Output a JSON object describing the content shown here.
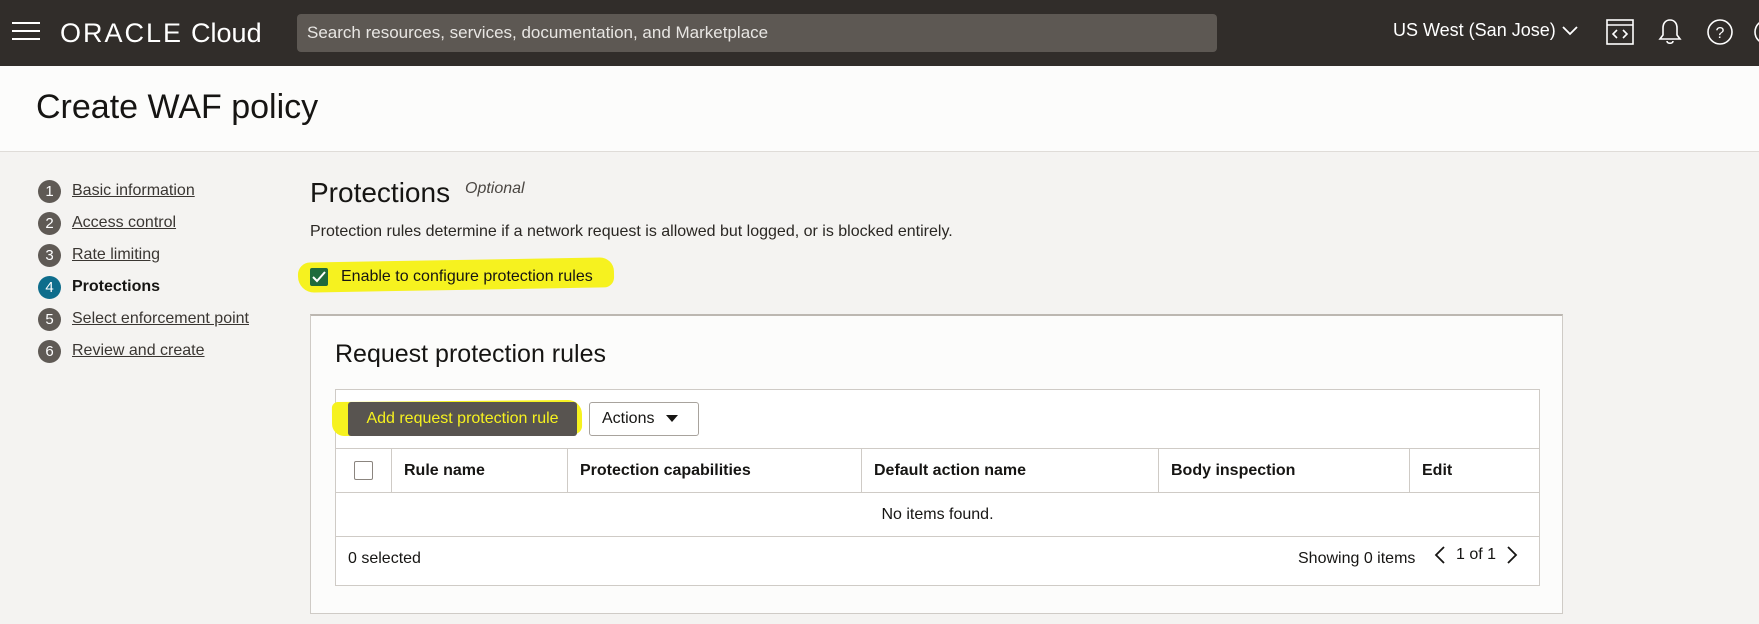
{
  "header": {
    "brand": "ORACLE",
    "product": "Cloud",
    "search_placeholder": "Search resources, services, documentation, and Marketplace",
    "region": "US West (San Jose)",
    "icons": [
      "hamburger-icon",
      "code-editor-icon",
      "bell-icon",
      "help-icon"
    ]
  },
  "page": {
    "title": "Create WAF policy"
  },
  "steps": [
    {
      "num": "1",
      "label": "Basic information",
      "active": false
    },
    {
      "num": "2",
      "label": "Access control",
      "active": false
    },
    {
      "num": "3",
      "label": "Rate limiting",
      "active": false
    },
    {
      "num": "4",
      "label": "Protections",
      "active": true
    },
    {
      "num": "5",
      "label": "Select enforcement point",
      "active": false
    },
    {
      "num": "6",
      "label": "Review and create",
      "active": false
    }
  ],
  "section": {
    "title": "Protections",
    "optional": "Optional",
    "description": "Protection rules determine if a network request is allowed but logged, or is blocked entirely.",
    "checkbox_label": "Enable to configure protection rules",
    "checkbox_checked": true
  },
  "panel": {
    "title": "Request protection rules",
    "add_button": "Add request protection rule",
    "actions_button": "Actions",
    "columns": [
      "Rule name",
      "Protection capabilities",
      "Default action name",
      "Body inspection",
      "Edit"
    ],
    "empty_message": "No items found.",
    "selected": "0 selected",
    "showing": "Showing 0 items",
    "page": "1 of 1"
  },
  "colors": {
    "topbar": "#312d2a",
    "active_step": "#0e6d8c",
    "highlight": "#f6f21f",
    "checkbox": "#1e6b3c"
  }
}
